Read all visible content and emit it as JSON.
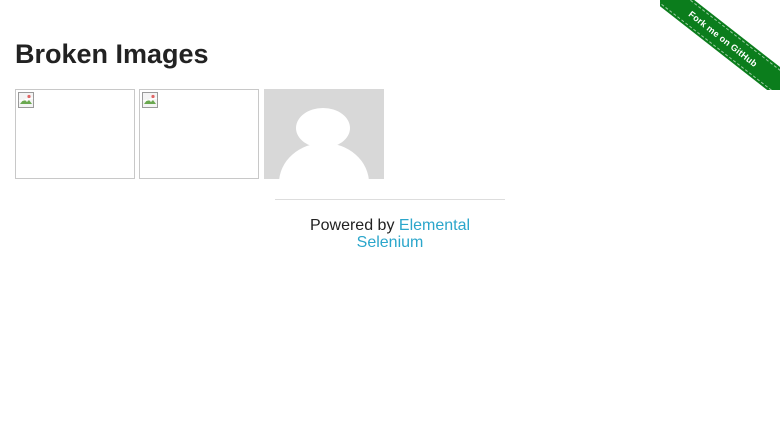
{
  "ribbon": {
    "label": "Fork me on GitHub",
    "color": "#0b7d1c"
  },
  "page": {
    "title": "Broken Images"
  },
  "images": [
    {
      "state": "broken",
      "icon": "broken-image-icon"
    },
    {
      "state": "broken",
      "icon": "broken-image-icon"
    },
    {
      "state": "loaded",
      "icon": "avatar-placeholder"
    }
  ],
  "footer": {
    "prefix": "Powered by ",
    "link_text": "Elemental Selenium",
    "link_color": "#2ba6cb"
  }
}
